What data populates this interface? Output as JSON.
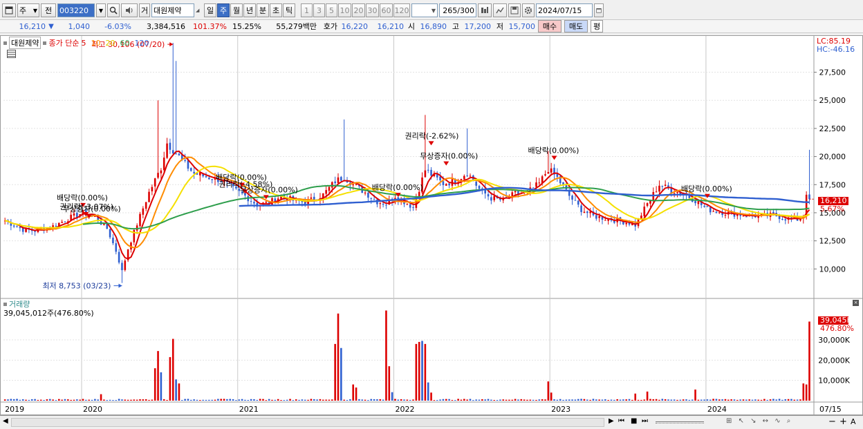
{
  "toolbar": {
    "menu_icon": "window-icon",
    "market_select": "주",
    "prev_label": "전",
    "stock_code": "003220",
    "category_label": "거",
    "stock_name": "대원제약",
    "periods": [
      "일",
      "주",
      "월",
      "년",
      "분",
      "초",
      "틱"
    ],
    "selected_period": "주",
    "intervals": [
      "1",
      "3",
      "5",
      "10",
      "20",
      "30",
      "60",
      "120"
    ],
    "count_value": "265",
    "count_total": "/300",
    "date_value": "2024/07/15"
  },
  "quote": {
    "price": "16,210",
    "direction_icon": "down-triangle-icon",
    "change": "1,040",
    "change_pct": "-6.03%",
    "volume": "3,384,516",
    "volume_ratio": "101.37%",
    "turnover": "15.25%",
    "amount": "55,279백만",
    "ask_label": "호가",
    "ask": "16,220",
    "bid": "16,210",
    "open_label": "시",
    "open": "16,890",
    "high_label": "고",
    "high": "17,200",
    "low_label": "저",
    "low": "15,700",
    "buy_label": "매수",
    "sell_label": "매도",
    "eval_label": "평"
  },
  "legend": {
    "stock_name": "대원제약",
    "ma_prefix": "종가 단순",
    "ma_periods": [
      "5",
      "10",
      "20",
      "60",
      "120"
    ],
    "ma_colors": [
      "#dd0000",
      "#ff8c00",
      "#f5e000",
      "#2e9e4c",
      "#2f5fd0"
    ]
  },
  "indicator": {
    "lc": "LC:85.19",
    "hc": "HC:-46.16"
  },
  "volume_panel": {
    "title": "거래량",
    "current": "39,045,012주(476.80%)",
    "current_badge": "39,045K",
    "ratio_badge": "476.80%"
  },
  "price_badge": {
    "price": "16,210",
    "change_pct": "5.67%"
  },
  "bottom": {
    "nav_icons": [
      "scroll-right-icon",
      "first-icon",
      "stop-icon",
      "last-icon"
    ],
    "tool_icons": [
      "zoom-minus-icon",
      "zoom-plus-icon",
      "text-tool-icon"
    ]
  },
  "colors": {
    "up": "#dd0000",
    "down": "#2f5fd0",
    "accent": "#3c6fc6"
  },
  "chart_data": [
    {
      "type": "candlestick",
      "title": "",
      "y_ticks": [
        10000,
        12500,
        15000,
        17500,
        20000,
        22500,
        25000,
        27500
      ],
      "y_tick_labels": [
        "10,000",
        "12,500",
        "15,000",
        "17,500",
        "20,000",
        "22,500",
        "25,000",
        "27,500"
      ],
      "ylim": [
        7500,
        29500
      ],
      "x_tick_labels": [
        "2019",
        "2020",
        "2021",
        "2022",
        "2023",
        "2024",
        "07/15"
      ],
      "x_tick_weeks": [
        0,
        26,
        78,
        130,
        182,
        234,
        270
      ],
      "highest_label": "최고 30,106 (07/20)",
      "highest_value": 30106,
      "lowest_label": "최저 8,753 (03/23)",
      "lowest_value": 8753,
      "last_close": 16210,
      "anchors": [
        [
          0,
          14300
        ],
        [
          6,
          13500
        ],
        [
          10,
          13400
        ],
        [
          16,
          13800
        ],
        [
          22,
          14600
        ],
        [
          26,
          15000
        ],
        [
          30,
          14600
        ],
        [
          34,
          13600
        ],
        [
          37,
          11600
        ],
        [
          39,
          9800
        ],
        [
          41,
          11800
        ],
        [
          44,
          14000
        ],
        [
          48,
          16800
        ],
        [
          52,
          19000
        ],
        [
          54,
          21200
        ],
        [
          57,
          20300
        ],
        [
          60,
          19300
        ],
        [
          63,
          18500
        ],
        [
          67,
          18200
        ],
        [
          72,
          17900
        ],
        [
          76,
          17100
        ],
        [
          80,
          16500
        ],
        [
          84,
          15700
        ],
        [
          88,
          15900
        ],
        [
          92,
          16500
        ],
        [
          96,
          16100
        ],
        [
          100,
          15900
        ],
        [
          106,
          16600
        ],
        [
          110,
          17800
        ],
        [
          113,
          18200
        ],
        [
          116,
          17500
        ],
        [
          120,
          16800
        ],
        [
          124,
          16000
        ],
        [
          127,
          15800
        ],
        [
          130,
          16500
        ],
        [
          133,
          16000
        ],
        [
          136,
          15500
        ],
        [
          140,
          18800
        ],
        [
          143,
          18200
        ],
        [
          146,
          17600
        ],
        [
          150,
          17800
        ],
        [
          154,
          18600
        ],
        [
          158,
          17100
        ],
        [
          162,
          16300
        ],
        [
          166,
          16100
        ],
        [
          170,
          16700
        ],
        [
          174,
          16800
        ],
        [
          178,
          17600
        ],
        [
          181,
          18900
        ],
        [
          184,
          18100
        ],
        [
          188,
          16500
        ],
        [
          192,
          15300
        ],
        [
          196,
          14700
        ],
        [
          200,
          14500
        ],
        [
          204,
          14300
        ],
        [
          208,
          14100
        ],
        [
          210,
          13900
        ],
        [
          214,
          15800
        ],
        [
          218,
          17500
        ],
        [
          222,
          17000
        ],
        [
          226,
          16700
        ],
        [
          230,
          16100
        ],
        [
          234,
          15300
        ],
        [
          240,
          15000
        ],
        [
          246,
          14800
        ],
        [
          252,
          14700
        ],
        [
          256,
          14800
        ],
        [
          260,
          14500
        ],
        [
          264,
          14400
        ],
        [
          266,
          14800
        ],
        [
          267,
          16800
        ],
        [
          268,
          16210
        ]
      ],
      "spikes": [
        [
          56,
          30106
        ],
        [
          51,
          25000
        ],
        [
          57,
          28500
        ],
        [
          140,
          23700
        ],
        [
          113,
          23300
        ],
        [
          154,
          22500
        ],
        [
          181,
          20500
        ],
        [
          268,
          20600
        ]
      ],
      "ma_series_names": [
        "5",
        "10",
        "20",
        "60",
        "120"
      ],
      "annotations": [
        {
          "text": "배당락(0.00%)",
          "week": 26,
          "value": 15500,
          "color": "#000"
        },
        {
          "text": "권리락(-3.07%)",
          "week": 27,
          "value": 14700,
          "color": "#000"
        },
        {
          "text": "무상증자(0.00%)",
          "week": 28,
          "value": 14500,
          "color": "#000"
        },
        {
          "text": "배당락(0.00%)",
          "week": 79,
          "value": 17300,
          "color": "#000"
        },
        {
          "text": "권리락(-4.58%)",
          "week": 80,
          "value": 16700,
          "color": "#000"
        },
        {
          "text": "무상증자(0.00%)",
          "week": 87,
          "value": 16200,
          "color": "#000"
        },
        {
          "text": "배당락(0.00%)",
          "week": 131,
          "value": 16400,
          "color": "#000"
        },
        {
          "text": "권리락(-2.62%)",
          "week": 142,
          "value": 21000,
          "color": "#000"
        },
        {
          "text": "무상증자(0.00%)",
          "week": 147,
          "value": 19200,
          "color": "#000"
        },
        {
          "text": "배당락(0.00%)",
          "week": 183,
          "value": 19700,
          "color": "#000"
        },
        {
          "text": "배당락(0.00%)",
          "week": 234,
          "value": 16300,
          "color": "#000"
        }
      ]
    },
    {
      "type": "bar",
      "title": "거래량",
      "y_ticks": [
        10000,
        20000,
        30000
      ],
      "y_tick_labels": [
        "10,000K",
        "20,000K",
        "30,000K"
      ],
      "ylim": [
        0,
        45000
      ],
      "unit": "K",
      "baseline": 600,
      "spikes": [
        [
          32,
          3200
        ],
        [
          50,
          16000
        ],
        [
          51,
          24500
        ],
        [
          52,
          14000
        ],
        [
          55,
          21500
        ],
        [
          56,
          30500
        ],
        [
          57,
          10500
        ],
        [
          58,
          8500
        ],
        [
          110,
          28000
        ],
        [
          111,
          43000
        ],
        [
          112,
          26000
        ],
        [
          116,
          8000
        ],
        [
          117,
          6500
        ],
        [
          127,
          44500
        ],
        [
          128,
          17000
        ],
        [
          129,
          4200
        ],
        [
          137,
          28000
        ],
        [
          138,
          29000
        ],
        [
          139,
          29500
        ],
        [
          140,
          28000
        ],
        [
          141,
          9000
        ],
        [
          142,
          4000
        ],
        [
          181,
          9500
        ],
        [
          182,
          4000
        ],
        [
          210,
          3500
        ],
        [
          214,
          4500
        ],
        [
          230,
          5500
        ],
        [
          266,
          8500
        ],
        [
          267,
          8000
        ],
        [
          268,
          39045
        ]
      ]
    }
  ]
}
